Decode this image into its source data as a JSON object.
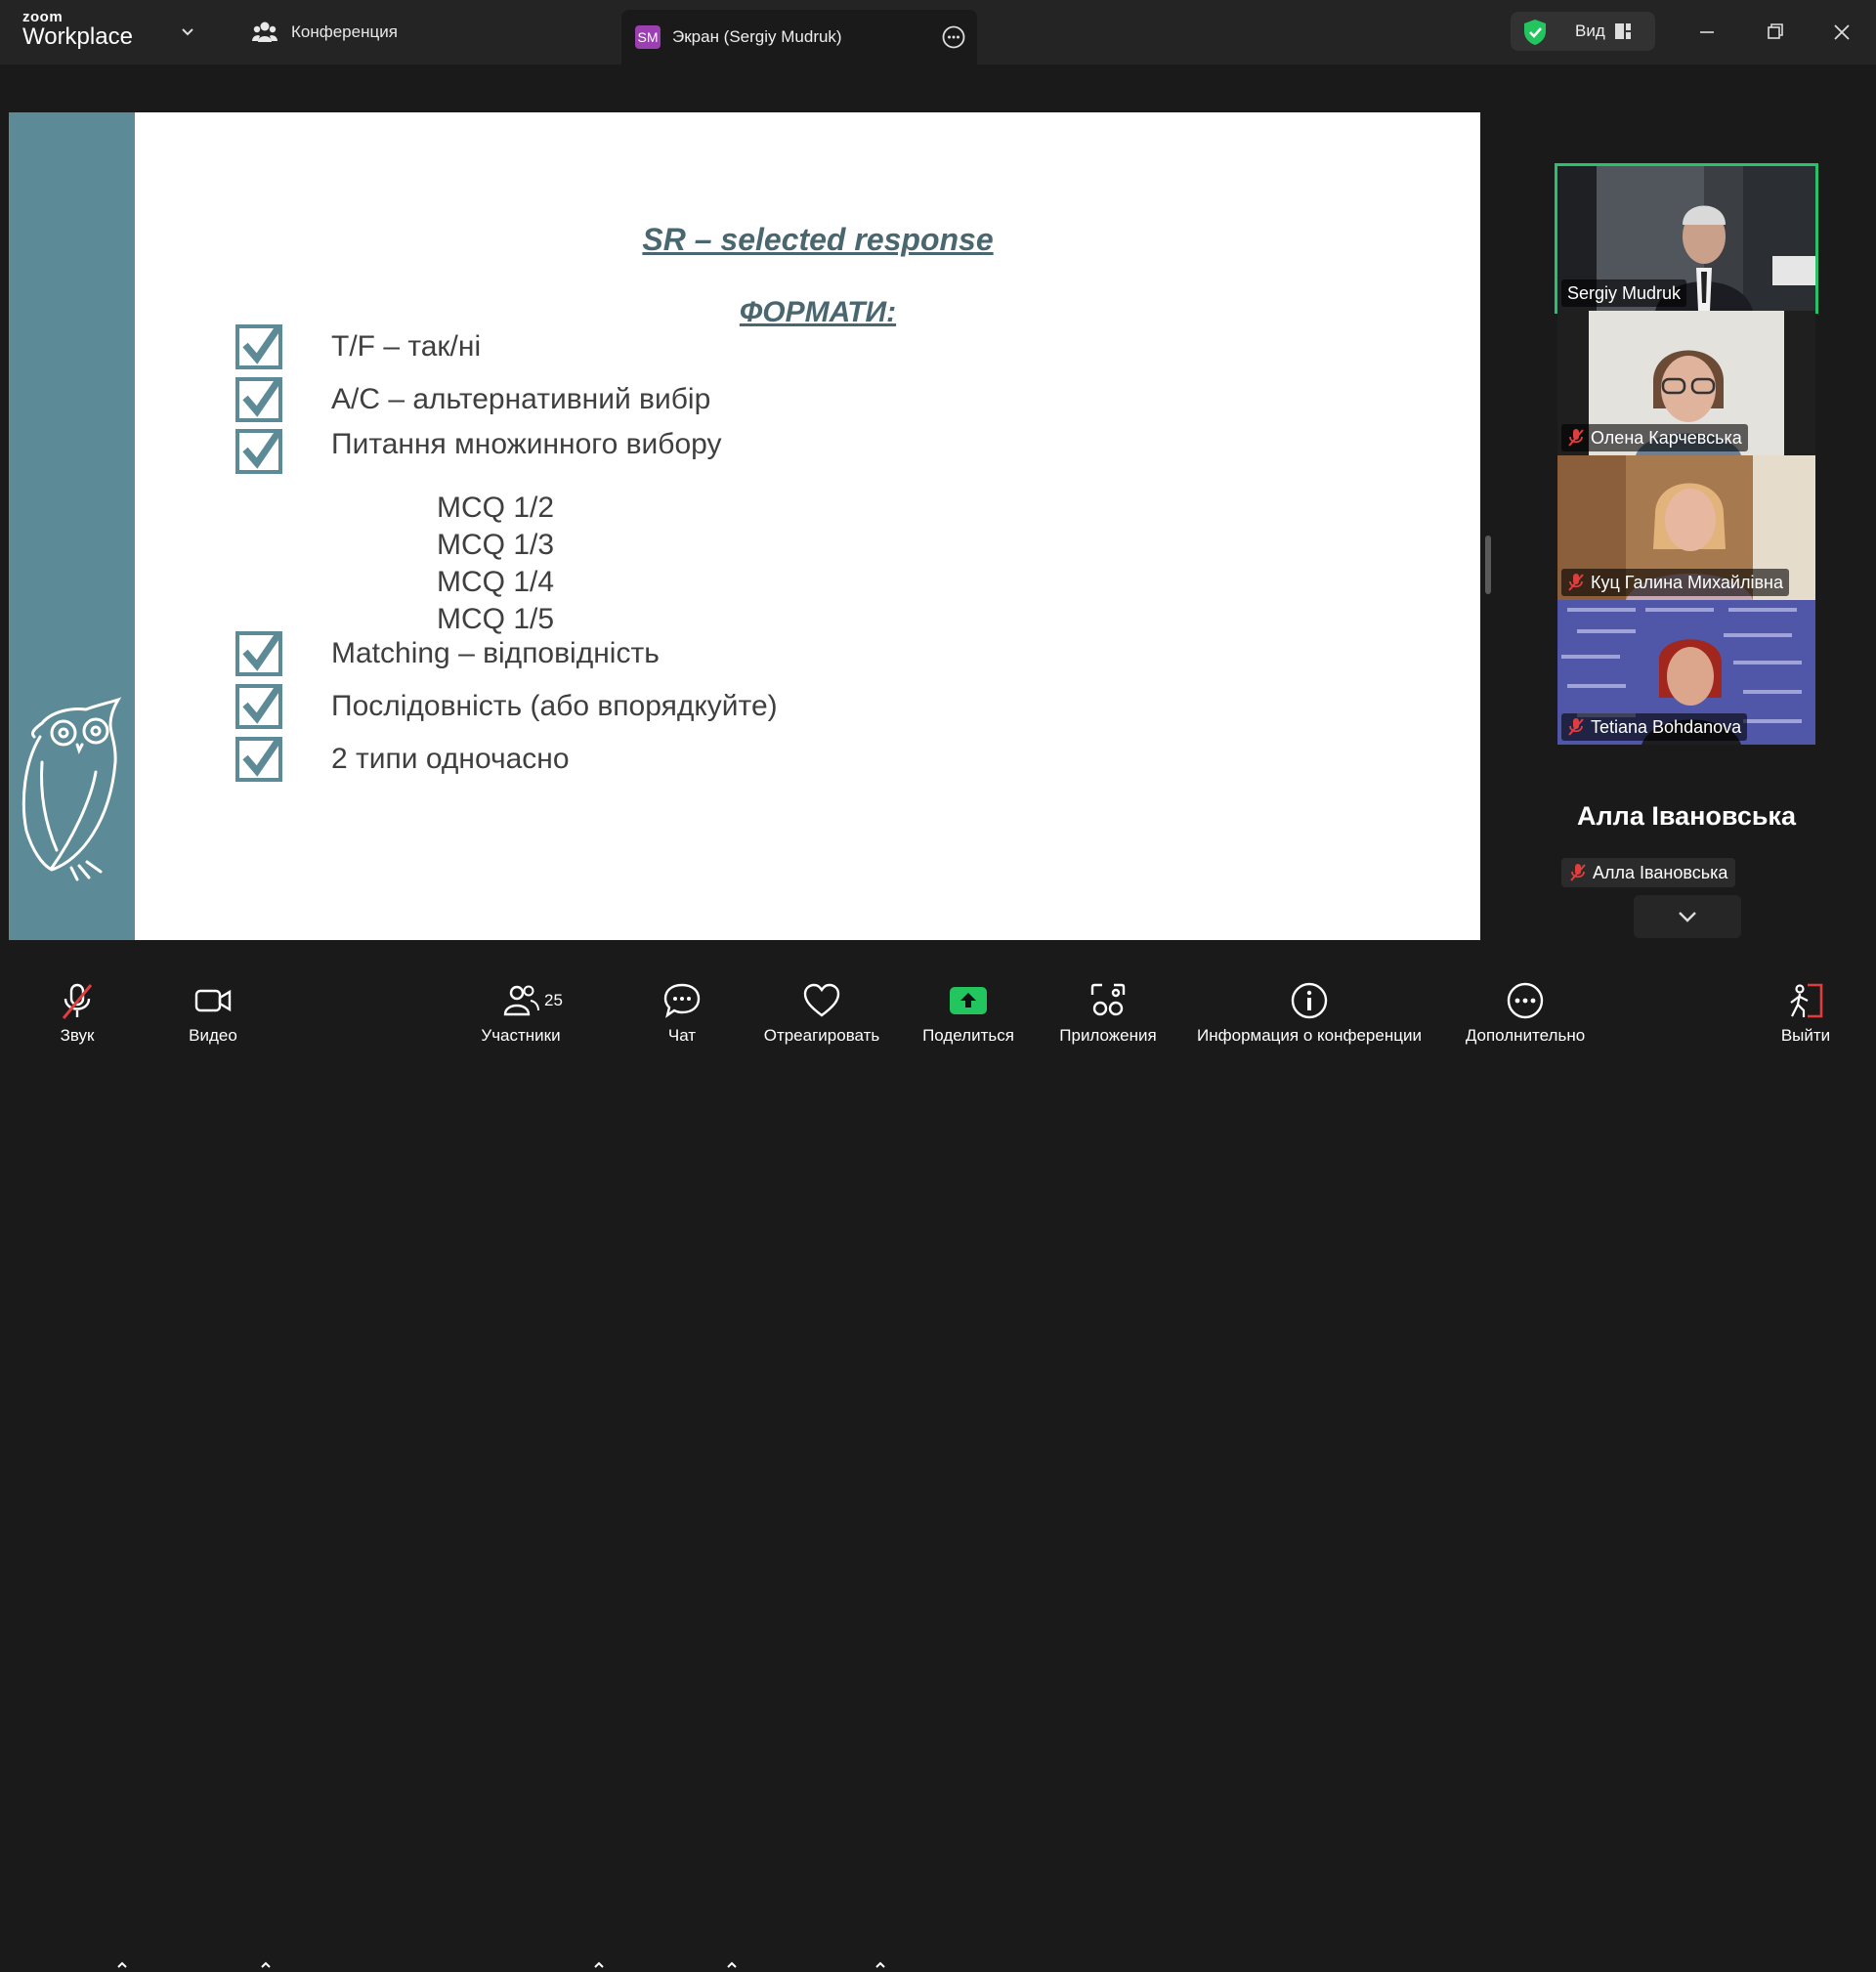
{
  "app": {
    "brand_top": "zoom",
    "brand_bottom": "Workplace"
  },
  "header": {
    "conference_label": "Конференция",
    "screen_share_label": "Экран (Sergiy Mudruk)",
    "screen_share_initials": "SM",
    "view_label": "Вид"
  },
  "slide": {
    "title": "SR – selected response",
    "subtitle": "ФОРМАТИ:",
    "items": [
      "T/F – так/ні",
      "A/C – альтернативний вибір",
      "Питання множинного вибору"
    ],
    "mcq": [
      "MCQ 1/2",
      "MCQ 1/3",
      "MCQ 1/4",
      "MCQ 1/5"
    ],
    "items2": [
      "Matching – відповідність",
      "Послідовність (або впорядкуйте)",
      "2 типи одночасно"
    ]
  },
  "participants_panel": {
    "tiles": [
      {
        "name": "Sergiy Mudruk",
        "muted": false,
        "active": true
      },
      {
        "name": "Олена Карчевська",
        "muted": true,
        "active": false
      },
      {
        "name": "Куц Галина Михайлівна",
        "muted": true,
        "active": false
      },
      {
        "name": "Tetiana Bohdanova",
        "muted": true,
        "active": false
      }
    ],
    "big_name": "Алла Івановська",
    "chip_name": "Алла Івановська"
  },
  "toolbar": {
    "audio_label": "Звук",
    "video_label": "Видео",
    "participants_label": "Участники",
    "participants_count": "25",
    "chat_label": "Чат",
    "react_label": "Отреагировать",
    "share_label": "Поделиться",
    "apps_label": "Приложения",
    "info_label": "Информация о конференции",
    "more_label": "Дополнительно",
    "leave_label": "Выйти"
  },
  "colors": {
    "accent_green": "#22c55e",
    "slide_strip": "#5c8a96",
    "leave_red": "#e03e3e"
  }
}
